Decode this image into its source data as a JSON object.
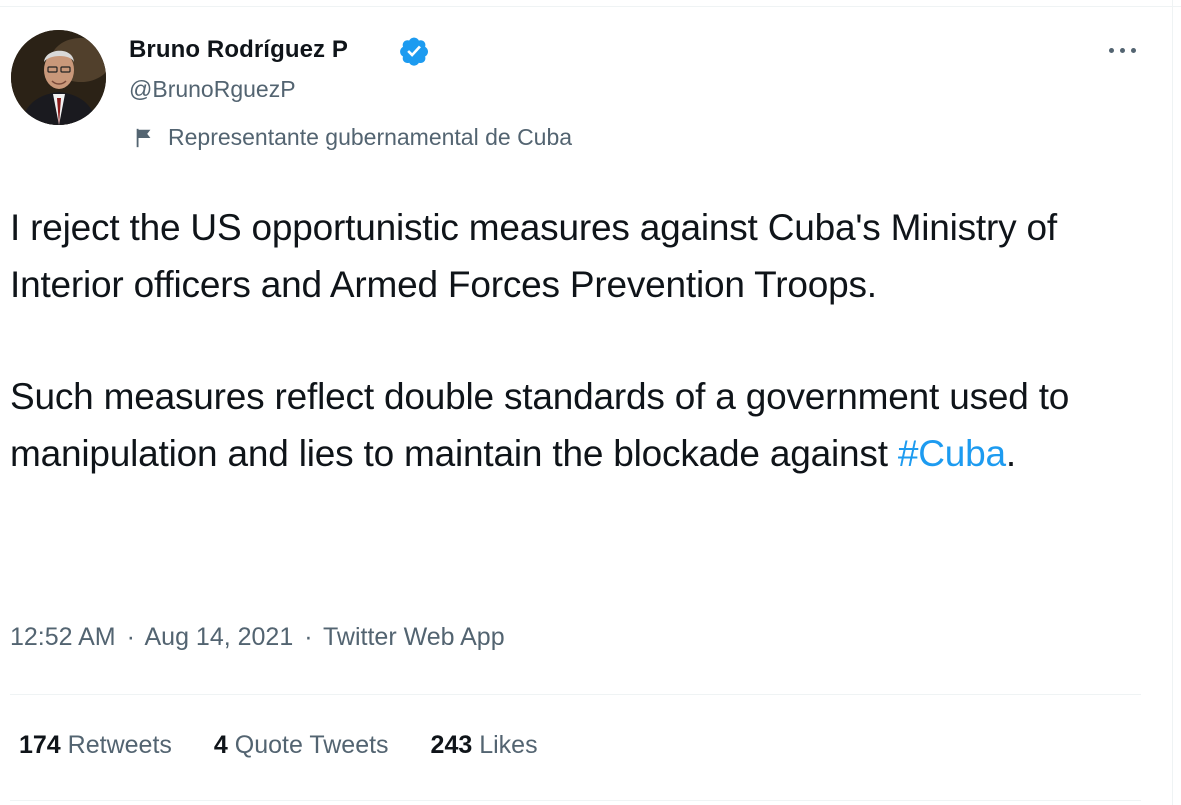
{
  "user": {
    "name": "Bruno Rodríguez P",
    "handle": "@BrunoRguezP",
    "label": "Representante gubernamental de Cuba"
  },
  "tweet": {
    "paragraph1": "I reject the US opportunistic measures against Cuba's Ministry of Interior officers and Armed Forces Prevention Troops.",
    "paragraph2_text": "Such measures reflect double standards of a government used to manipulation and lies to maintain the blockade against ",
    "hashtag": "#Cuba",
    "paragraph2_end": "."
  },
  "meta": {
    "time": "12:52 AM",
    "separator": "·",
    "date": "Aug 14, 2021",
    "source": "Twitter Web App"
  },
  "stats": {
    "retweets_count": "174",
    "retweets_label": "Retweets",
    "quotes_count": "4",
    "quotes_label": "Quote Tweets",
    "likes_count": "243",
    "likes_label": "Likes"
  },
  "colors": {
    "text": "#0f1419",
    "secondary": "#536471",
    "accent": "#1d9bf0",
    "divider": "#eff3f4"
  },
  "icons": {
    "verified": "verified-badge-icon",
    "label_flag": "flag-icon",
    "more": "more-options-icon"
  }
}
